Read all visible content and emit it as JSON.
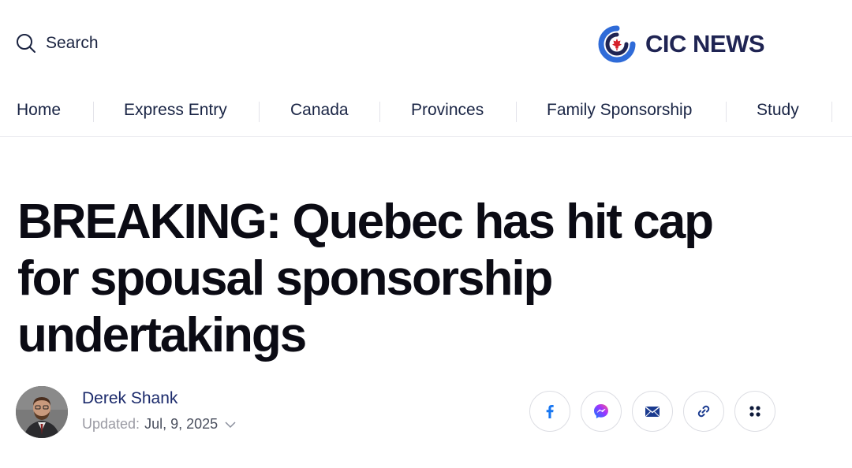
{
  "header": {
    "search_label": "Search",
    "logo_text": "CIC NEWS"
  },
  "nav": {
    "items": [
      {
        "label": "Home"
      },
      {
        "label": "Express Entry"
      },
      {
        "label": "Canada"
      },
      {
        "label": "Provinces"
      },
      {
        "label": "Family Sponsorship"
      },
      {
        "label": "Study"
      }
    ]
  },
  "article": {
    "headline": "BREAKING: Quebec has hit cap for spousal sponsorship undertakings",
    "author": "Derek Shank",
    "updated_label": "Updated:",
    "updated_date": "Jul, 9, 2025"
  },
  "share": {
    "buttons": [
      "facebook-icon",
      "messenger-icon",
      "email-icon",
      "link-icon",
      "more-icon"
    ]
  },
  "colors": {
    "brand_navy": "#1f2453",
    "brand_blue": "#2f6bd8",
    "maple_red": "#d6202a",
    "icon_blue": "#1877f2"
  }
}
